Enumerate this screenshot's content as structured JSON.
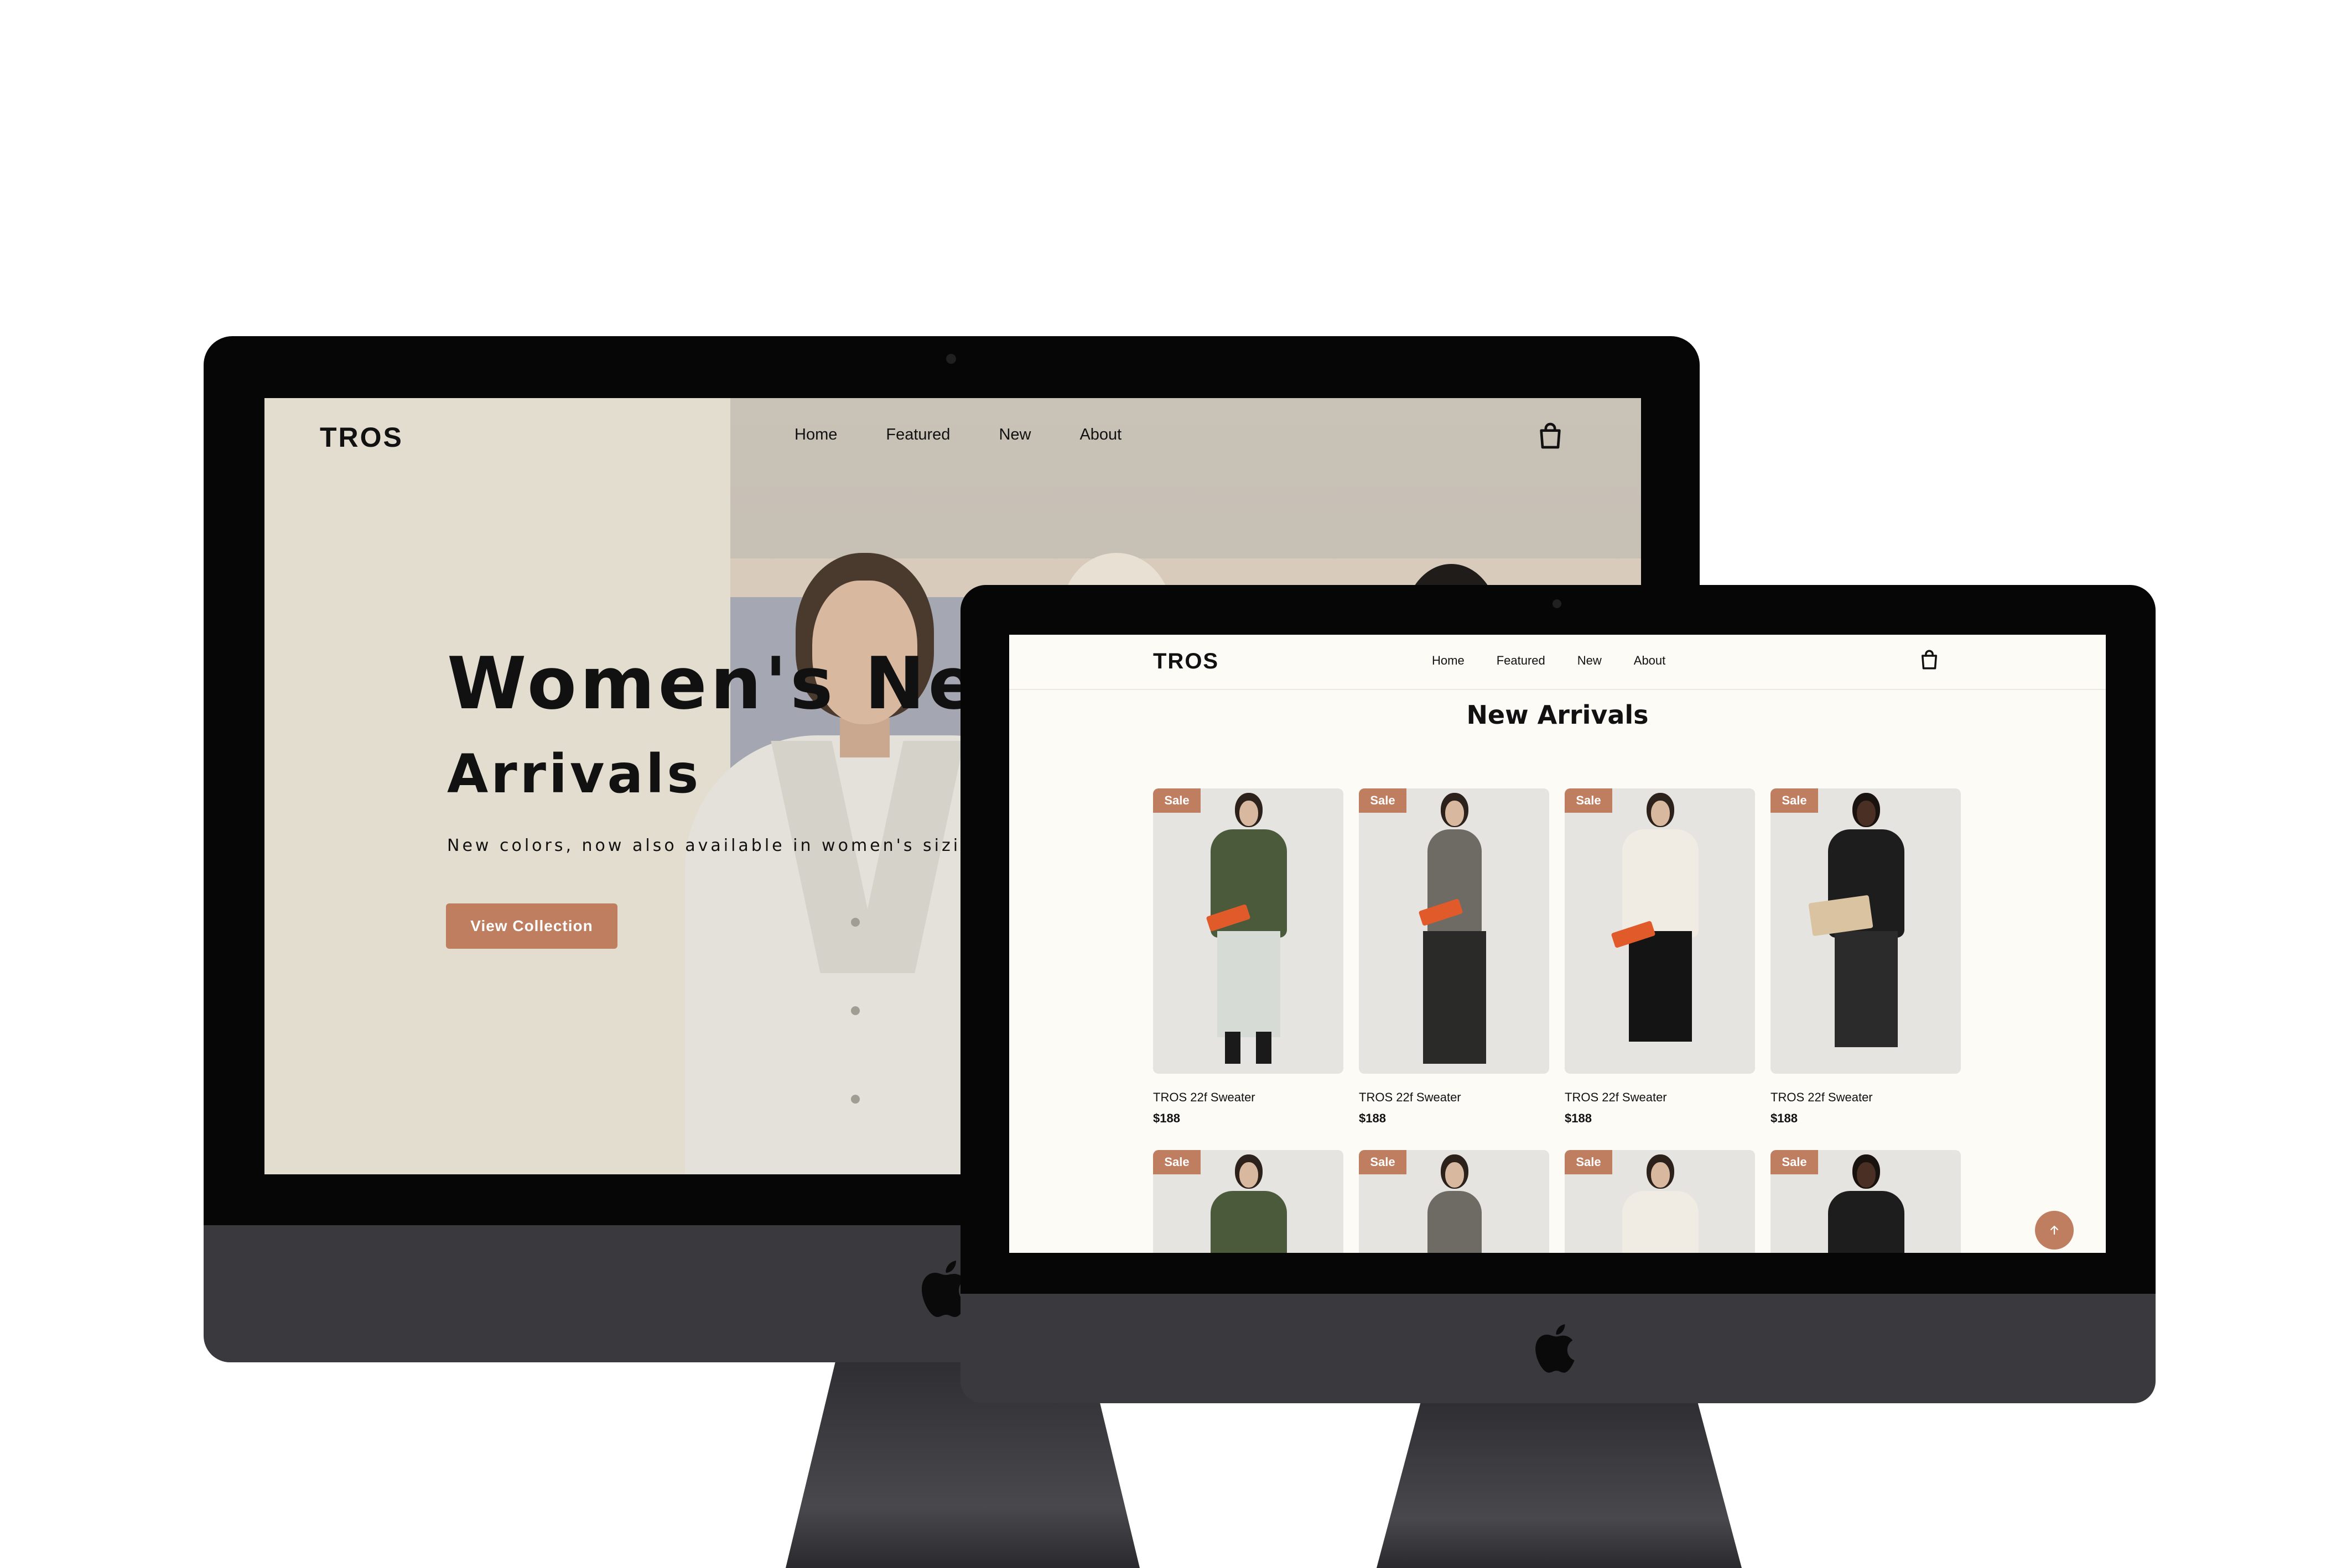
{
  "desktop_large": {
    "brand": "TROS",
    "nav": [
      "Home",
      "Featured",
      "New",
      "About"
    ],
    "hero": {
      "title_line1": "Women's New",
      "title_line2": "Arrivals",
      "subtitle": "New colors, now also available in women's sizing.",
      "cta_label": "View Collection"
    },
    "icons": {
      "cart": "shopping-bag-icon",
      "logo": "apple-logo-icon"
    }
  },
  "desktop_small": {
    "brand": "TROS",
    "nav": [
      "Home",
      "Featured",
      "New",
      "About"
    ],
    "section_title": "New Arrivals",
    "badge_label": "Sale",
    "products": [
      {
        "name": "TROS 22f Sweater",
        "price": "$188"
      },
      {
        "name": "TROS 22f Sweater",
        "price": "$188"
      },
      {
        "name": "TROS 22f Sweater",
        "price": "$188"
      },
      {
        "name": "TROS 22f Sweater",
        "price": "$188"
      }
    ],
    "second_row_badges": [
      "Sale",
      "Sale",
      "Sale",
      "Sale"
    ],
    "scroll_top_icon": "arrow-up-icon",
    "icons": {
      "cart": "shopping-bag-icon",
      "logo": "apple-logo-icon"
    }
  },
  "colors": {
    "accent": "#c07e61",
    "hero_bg": "#e3ddd0",
    "grid_bg": "#fcfbf6",
    "bezel": "#060606",
    "chassis": "#3a3a3e"
  }
}
